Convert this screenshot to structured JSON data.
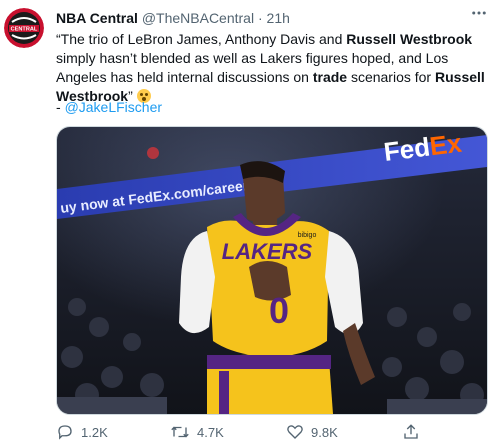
{
  "tweet": {
    "author": {
      "name": "NBA Central",
      "handle": "@TheNBACentral",
      "time": "21h",
      "avatar_text": "CENTRAL"
    },
    "text_parts": [
      "“The trio of LeBron James, Anthony Davis and ",
      "Russell Westbrook",
      " simply hasn’t blended as well as Lakers figures hoped, and Los Angeles has held internal discussions on ",
      "trade",
      " scenarios for ",
      "Russell Westbrook",
      "”"
    ],
    "credit_prefix": "- ",
    "credit_link": "@JakeLFischer",
    "media": {
      "banner_left": "uy now at FedEx.com/careers",
      "fedex_fed": "Fed",
      "fedex_ex": "Ex",
      "jersey_team": "LAKERS",
      "jersey_number": "0",
      "jersey_patch": "bibigo"
    },
    "actions": {
      "replies": "1.2K",
      "retweets": "4.7K",
      "likes": "9.8K"
    }
  },
  "colors": {
    "link": "#1d9bf0",
    "secondary_text": "#536471",
    "lakers_gold": "#f5c31c",
    "lakers_purple": "#552583",
    "fedex_purple": "#4d148c",
    "fedex_orange": "#ff6600"
  },
  "icons": [
    "avatar-logo",
    "more-icon",
    "flushed-emoji-icon",
    "reply-icon",
    "retweet-icon",
    "like-icon",
    "share-icon"
  ]
}
